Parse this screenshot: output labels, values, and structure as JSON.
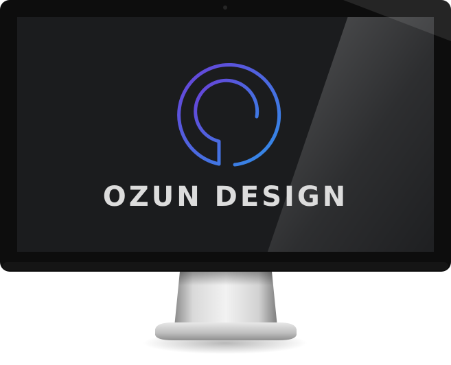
{
  "brand": {
    "name": "OZUN DESIGN",
    "logo_icon": "ozun-ring-logo",
    "gradient": {
      "start": "#6a3fd8",
      "end": "#2f8fe8"
    },
    "text_color": "#dcdcdc"
  },
  "device": {
    "type": "desktop-monitor",
    "bezel_color": "#0d0d0d",
    "screen_color": "#1b1c1e",
    "stand_color": "#c8c8c8"
  }
}
